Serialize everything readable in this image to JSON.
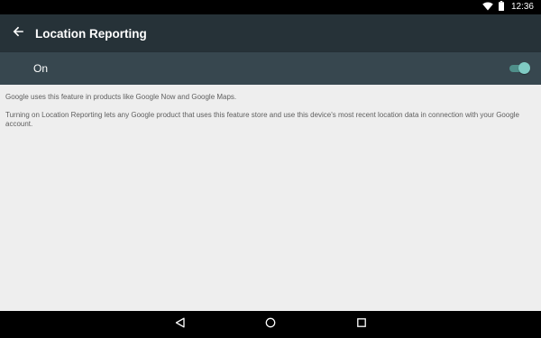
{
  "status_bar": {
    "time": "12:36",
    "icons": [
      "wifi-icon",
      "battery-icon"
    ]
  },
  "toolbar": {
    "back_icon": "arrow-back-icon",
    "title": "Location Reporting"
  },
  "switch_bar": {
    "label": "On",
    "state": true,
    "track_color": "#4f8f8a",
    "thumb_color": "#80cbc4"
  },
  "content": {
    "paragraphs": [
      "Google uses this feature in products like Google Now and Google Maps.",
      "Turning on Location Reporting lets any Google product that uses this feature store and use this device's most recent location data in connection with your Google account."
    ]
  },
  "nav_bar": {
    "icons": [
      "back-triangle-icon",
      "home-circle-icon",
      "recents-square-icon"
    ]
  },
  "colors": {
    "toolbar": "#263238",
    "switch_bar": "#37474f",
    "background": "#eeeeee",
    "body_text": "#5f5f5f"
  }
}
